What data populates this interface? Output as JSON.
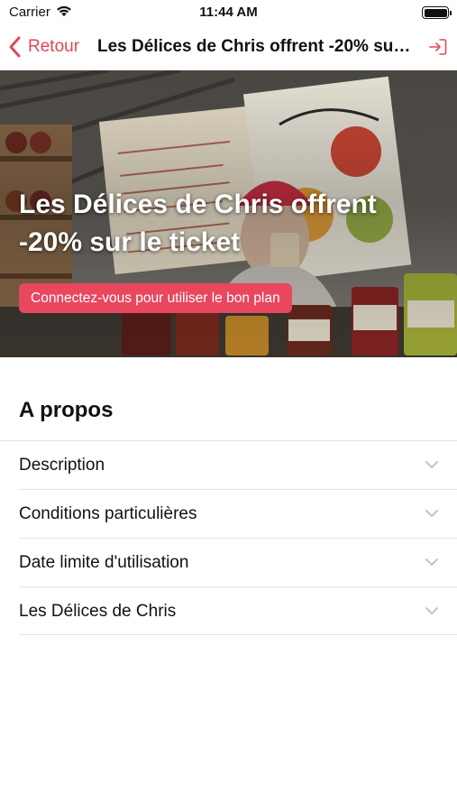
{
  "status_bar": {
    "carrier": "Carrier",
    "time": "11:44 AM",
    "icons": [
      "wifi-icon",
      "battery-icon"
    ]
  },
  "nav": {
    "back_label": "Retour",
    "title": "Les Délices de Chris offrent -20% sur le ticket",
    "icons": [
      "chevron-left-icon",
      "login-icon"
    ]
  },
  "hero": {
    "title": "Les Délices de Chris offrent -20% sur le ticket",
    "cta_label": "Connectez-vous pour utiliser le bon plan"
  },
  "about": {
    "title": "A propos",
    "items": [
      {
        "label": "Description"
      },
      {
        "label": "Conditions particulières"
      },
      {
        "label": "Date limite d'utilisation"
      },
      {
        "label": "Les Délices de Chris"
      }
    ]
  },
  "colors": {
    "accent": "#e0475a",
    "cta_background": "#e8475e",
    "divider": "#e3e3e6"
  }
}
